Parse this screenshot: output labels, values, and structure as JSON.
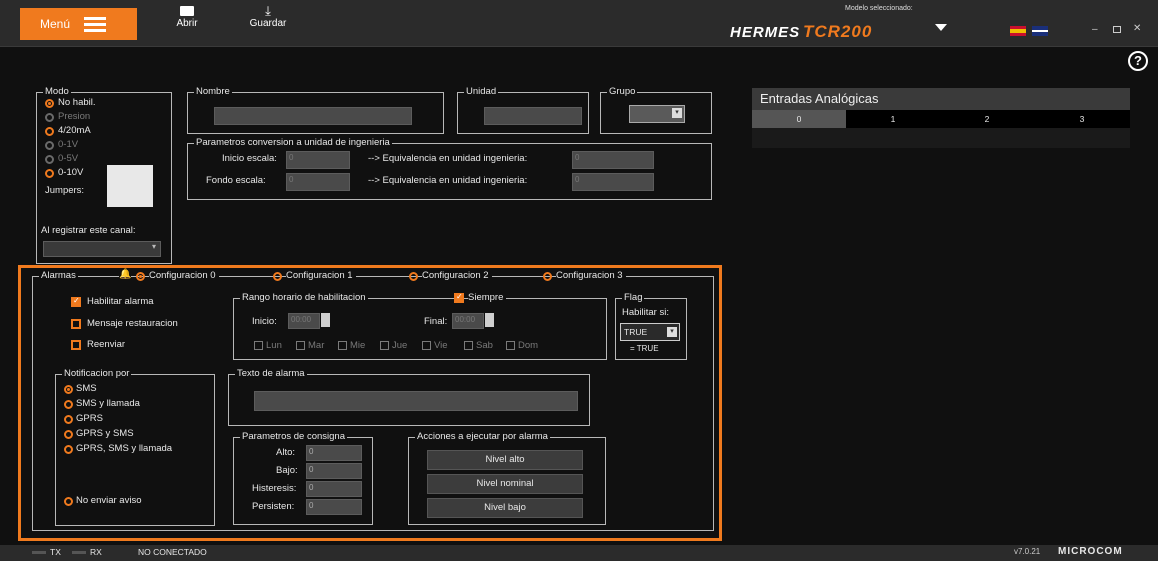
{
  "header": {
    "menu_label": "Menú",
    "open_label": "Abrir",
    "save_label": "Guardar",
    "model_label": "Modelo seleccionado:",
    "brand_hermes": "HERMES",
    "brand_model": "TCR200"
  },
  "modo": {
    "legend": "Modo",
    "options": [
      "No habil.",
      "Presion",
      "4/20mA",
      "0-1V",
      "0-5V",
      "0-10V"
    ],
    "jumpers_label": "Jumpers:",
    "registrar_label": "Al registrar este canal:"
  },
  "nombre": {
    "legend": "Nombre"
  },
  "unidad": {
    "legend": "Unidad"
  },
  "grupo": {
    "legend": "Grupo"
  },
  "conversion": {
    "legend": "Parametros conversion a unidad de ingenieria",
    "inicio_label": "Inicio escala:",
    "inicio_value": "0",
    "fondo_label": "Fondo escala:",
    "fondo_value": "0",
    "equiv_label": "--> Equivalencia en unidad ingenieria:",
    "equiv1_value": "0",
    "equiv2_value": "0"
  },
  "analog": {
    "title": "Entradas Analógicas",
    "tabs": [
      "0",
      "1",
      "2",
      "3"
    ]
  },
  "alarmas": {
    "legend": "Alarmas",
    "configs": [
      "Configuracion 0",
      "Configuracion 1",
      "Configuracion 2",
      "Configuracion 3"
    ],
    "habilitar": "Habilitar alarma",
    "mensaje": "Mensaje restauracion",
    "reenviar": "Reenviar",
    "rango_legend": "Rango horario de habilitacion",
    "siempre": "Siempre",
    "inicio_label": "Inicio:",
    "inicio_value": "00:00",
    "final_label": "Final:",
    "final_value": "00:00",
    "days": [
      "Lun",
      "Mar",
      "Mie",
      "Jue",
      "Vie",
      "Sab",
      "Dom"
    ],
    "flag_legend": "Flag",
    "habilitar_si": "Habilitar si:",
    "flag_value": "TRUE",
    "flag_eq": "= TRUE",
    "notif_legend": "Notificacion por",
    "notif_options": [
      "SMS",
      "SMS y llamada",
      "GPRS",
      "GPRS y SMS",
      "GPRS, SMS y llamada"
    ],
    "no_enviar": "No enviar aviso",
    "texto_legend": "Texto de alarma",
    "consigna_legend": "Parametros de consigna",
    "alto_label": "Alto:",
    "bajo_label": "Bajo:",
    "histeresis_label": "Histeresis:",
    "persisten_label": "Persisten:",
    "zero": "0",
    "acciones_legend": "Acciones a ejecutar por alarma",
    "nivel_alto": "Nivel alto",
    "nivel_nominal": "Nivel nominal",
    "nivel_bajo": "Nivel bajo"
  },
  "status": {
    "tx": "TX",
    "rx": "RX",
    "conn": "NO CONECTADO",
    "version": "v7.0.21",
    "company": "MICROCOM"
  },
  "colors": {
    "accent": "#f07a1e",
    "background": "#101010",
    "bar": "#2b2b2b"
  }
}
